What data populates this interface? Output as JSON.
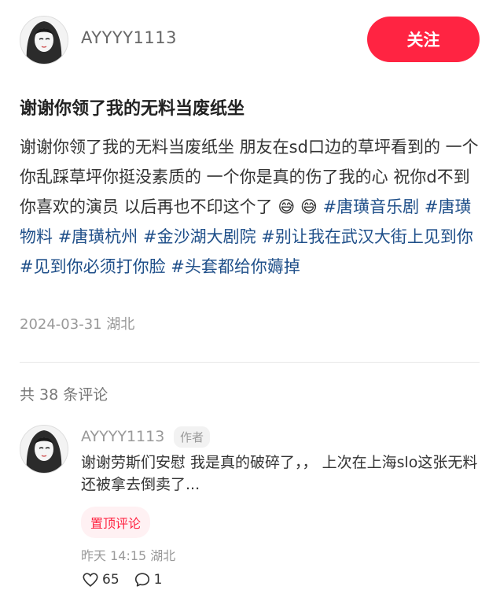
{
  "header": {
    "author_name": "AYYYY1113",
    "follow_label": "关注"
  },
  "post": {
    "title": "谢谢你领了我的无料当废纸坐",
    "body": "谢谢你领了我的无料当废纸坐 朋友在sd口边的草坪看到的 一个你乱踩草坪你挺没素质的 一个你是真的伤了我的心 祝你d不到你喜欢的演员 以后再也不印这个了",
    "emojis": [
      "😅",
      "😅"
    ],
    "tags": [
      "#唐璜音乐剧",
      "#唐璜物料",
      "#唐璜杭州",
      "#金沙湖大剧院",
      "#别让我在武汉大街上见到你",
      "#见到你必须打你脸",
      "#头套都给你薅掉"
    ],
    "date_location": "2024-03-31 湖北"
  },
  "comments": {
    "count_label": "共 38 条评论",
    "items": [
      {
        "name": "AYYYY1113",
        "badge": "作者",
        "text": "谢谢劳斯们安慰 我是真的破碎了，， 上次在上海slo这张无料还被拿去倒卖了...",
        "pin_label": "置顶评论",
        "meta": "昨天 14:15 湖北",
        "likes": "65",
        "replies": "1"
      }
    ]
  },
  "colors": {
    "accent": "#ff2442",
    "tag": "#1f4f89"
  },
  "icons": [
    "avatar-illustration",
    "heart-icon",
    "comment-bubble-icon"
  ]
}
